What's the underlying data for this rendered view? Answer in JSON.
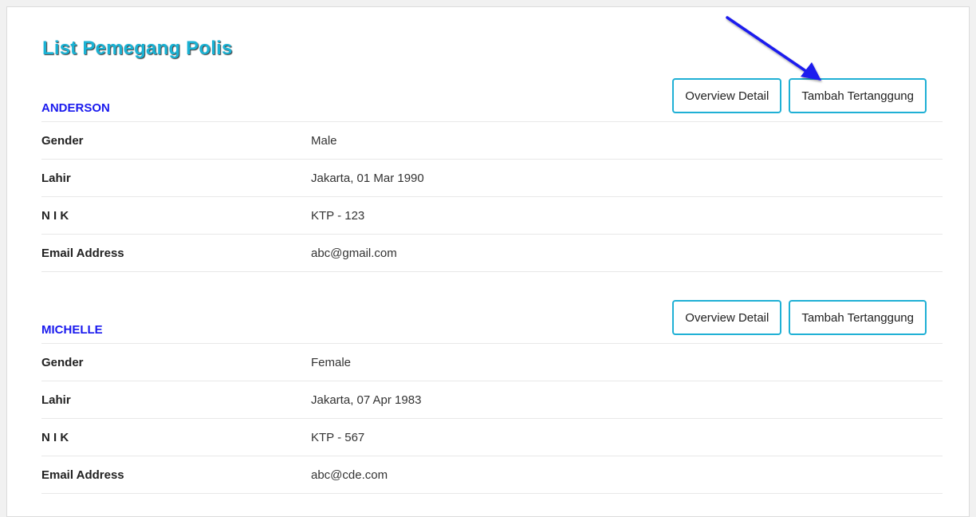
{
  "page": {
    "title": "List Pemegang Polis",
    "accent_color": "#1ab2d4",
    "name_color": "#1a1aee",
    "annotation_arrow_color": "#1a1aee"
  },
  "holders": [
    {
      "name": "ANDERSON",
      "buttons": {
        "overview": "Overview Detail",
        "add_insured": "Tambah Tertanggung"
      },
      "fields": [
        {
          "label": "Gender",
          "value": "Male"
        },
        {
          "label": "Lahir",
          "value": "Jakarta, 01 Mar 1990"
        },
        {
          "label": "N I K",
          "value": "KTP - 123"
        },
        {
          "label": "Email Address",
          "value": "abc@gmail.com"
        }
      ]
    },
    {
      "name": "MICHELLE",
      "buttons": {
        "overview": "Overview Detail",
        "add_insured": "Tambah Tertanggung"
      },
      "fields": [
        {
          "label": "Gender",
          "value": "Female"
        },
        {
          "label": "Lahir",
          "value": "Jakarta, 07 Apr 1983"
        },
        {
          "label": "N I K",
          "value": "KTP - 567"
        },
        {
          "label": "Email Address",
          "value": "abc@cde.com"
        }
      ]
    }
  ]
}
